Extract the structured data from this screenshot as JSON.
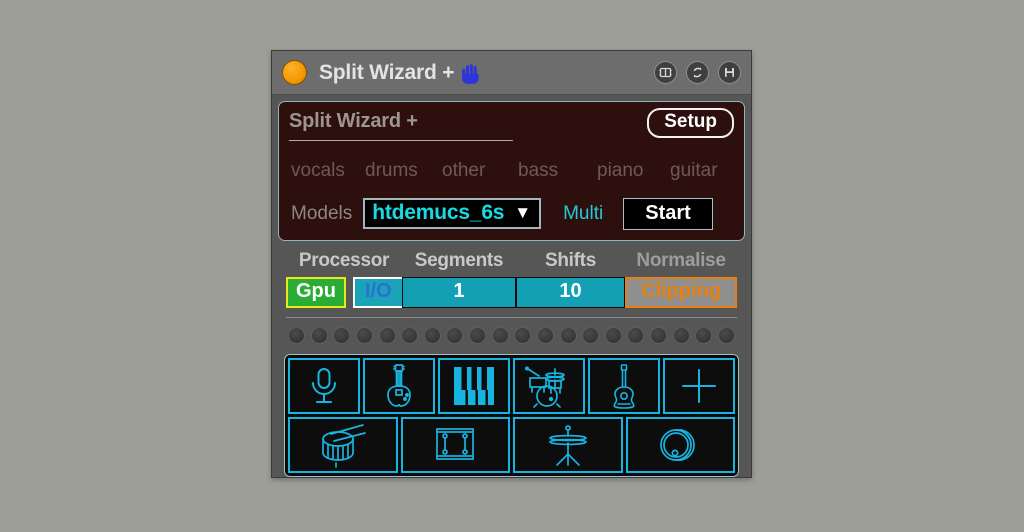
{
  "window": {
    "title": "Split Wizard +",
    "status_dot": "orange-status-dot",
    "hand_icon": "raised-hand-icon",
    "titlebar_icons": [
      {
        "name": "midi-device-icon",
        "label": "MIDI"
      },
      {
        "name": "refresh-icon",
        "label": "Reload"
      },
      {
        "name": "save-icon",
        "label": "Save"
      }
    ]
  },
  "panel": {
    "title": "Split Wizard +",
    "setup_label": "Setup",
    "stems": [
      {
        "label": "vocals"
      },
      {
        "label": "drums"
      },
      {
        "label": "other"
      },
      {
        "label": "bass"
      },
      {
        "label": "piano"
      },
      {
        "label": "guitar"
      }
    ],
    "models_label": "Models",
    "model_value": "htdemucs_6s",
    "model_caret": "▼",
    "multi_label": "Multi",
    "start_label": "Start"
  },
  "params": {
    "processor": {
      "title": "Processor",
      "gpu_label": "Gpu",
      "io_label": "I/O"
    },
    "segments": {
      "title": "Segments",
      "value": "1"
    },
    "shifts": {
      "title": "Shifts",
      "value": "10"
    },
    "normalise": {
      "title": "Normalise",
      "value": "Clipping"
    }
  },
  "dots": {
    "count": 20
  },
  "icon_grid": {
    "row1": [
      {
        "name": "microphone-icon"
      },
      {
        "name": "electric-guitar-icon"
      },
      {
        "name": "piano-keys-icon"
      },
      {
        "name": "drum-kit-icon"
      },
      {
        "name": "acoustic-guitar-icon"
      },
      {
        "name": "plus-icon"
      }
    ],
    "row2": [
      {
        "name": "snare-drum-icon"
      },
      {
        "name": "tom-drum-icon"
      },
      {
        "name": "hi-hat-cymbal-icon"
      },
      {
        "name": "kick-drum-icon"
      }
    ]
  },
  "colors": {
    "background": "#9e9e99",
    "window": "#565656",
    "titlebar": "#6d6d6d",
    "maroon_panel": "#2d0f0d",
    "accent_cyan": "#17b4e0",
    "teal_value": "#1ad9e0",
    "gpu_green": "#2bad35",
    "gpu_border_yellow": "#e8e81d",
    "io_teal": "#1ba3b8",
    "field_teal": "#13a0b5",
    "clipping_orange": "#e8800f",
    "status_orange": "#f59a06",
    "hand_blue": "#2b35d8"
  }
}
